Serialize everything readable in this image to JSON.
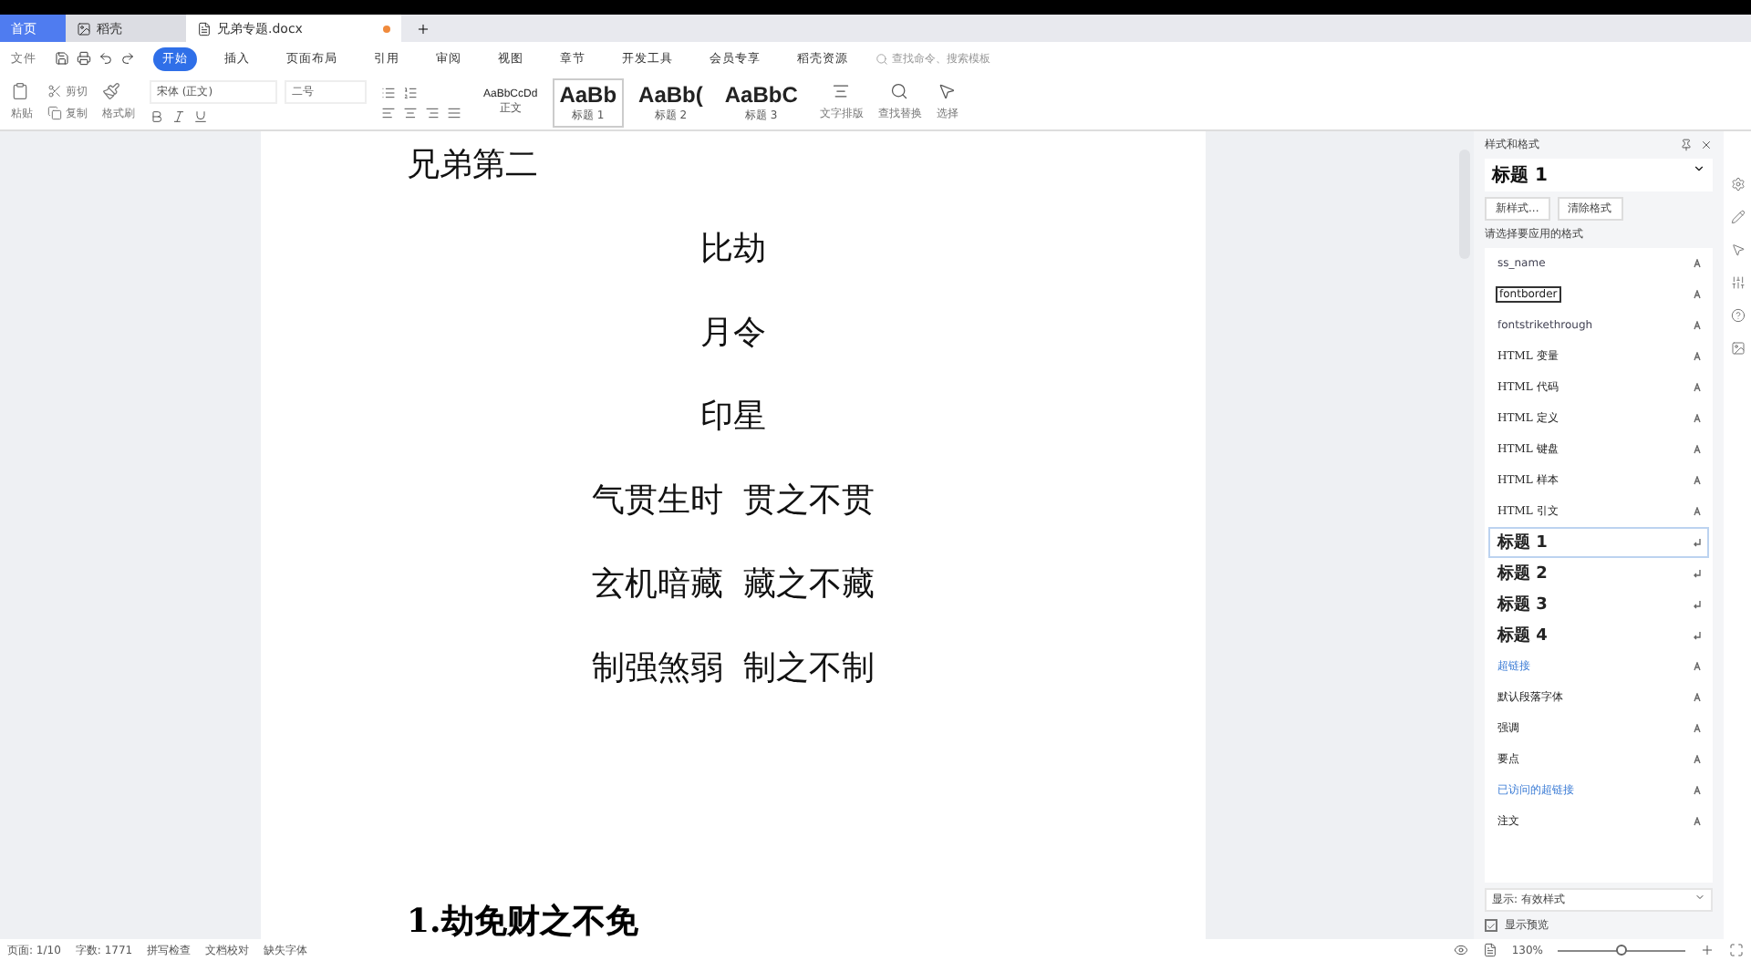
{
  "tabs": [
    {
      "label": "首页",
      "kind": "home",
      "selected": false
    },
    {
      "label": "稻壳",
      "kind": "app",
      "selected": false
    },
    {
      "label": "兄弟专题.docx",
      "kind": "doc",
      "selected": true
    }
  ],
  "menu": {
    "file": "文件",
    "items": [
      {
        "label": "开始",
        "selected": true
      },
      {
        "label": "插入",
        "selected": false
      },
      {
        "label": "页面布局",
        "selected": false
      },
      {
        "label": "引用",
        "selected": false
      },
      {
        "label": "审阅",
        "selected": false
      },
      {
        "label": "视图",
        "selected": false
      },
      {
        "label": "章节",
        "selected": false
      },
      {
        "label": "开发工具",
        "selected": false
      },
      {
        "label": "会员专享",
        "selected": false
      },
      {
        "label": "稻壳资源",
        "selected": false
      }
    ],
    "search": {
      "placeholder": "查找命令、搜索模板"
    }
  },
  "ribbon": {
    "paste": "粘贴",
    "cut": "剪切",
    "copy": "复制",
    "format_painter": "格式刷",
    "font": "宋体 (正文)",
    "size": "二号",
    "styles": [
      {
        "preview": "AaBbCcDd",
        "label": "正文",
        "selected": false
      },
      {
        "preview": "AaBb",
        "label": "标题 1",
        "selected": true
      },
      {
        "preview": "AaBb(",
        "label": "标题 2",
        "selected": false
      },
      {
        "preview": "AaBbC",
        "label": "标题 3",
        "selected": false
      }
    ],
    "tools": [
      "文字排版",
      "查找替换",
      "选择"
    ]
  },
  "document": {
    "lines": [
      {
        "text": "兄弟第二",
        "centered": false
      },
      {
        "text": "比劫",
        "centered": true
      },
      {
        "text": "月令",
        "centered": true
      },
      {
        "text": "印星",
        "centered": true
      },
      {
        "text": "气贯生时  贯之不贯",
        "centered": true
      },
      {
        "text": "玄机暗藏  藏之不藏",
        "centered": true
      },
      {
        "text": "制强煞弱  制之不制",
        "centered": true
      }
    ],
    "heading": "1.劫免财之不免"
  },
  "panel": {
    "title": "样式和格式",
    "current": "标题 1",
    "buttons": [
      "新样式...",
      "清除格式"
    ],
    "prompt": "请选择要应用的格式",
    "styles": [
      {
        "label": "ss_name",
        "kind": "small",
        "selected": false
      },
      {
        "label": "fontborder",
        "kind": "boxed",
        "selected": false
      },
      {
        "label": "fontstrikethrough",
        "kind": "small",
        "selected": false
      },
      {
        "label": "HTML 变量",
        "kind": "html",
        "selected": false
      },
      {
        "label": "HTML 代码",
        "kind": "html",
        "selected": false
      },
      {
        "label": "HTML 定义",
        "kind": "html",
        "selected": false
      },
      {
        "label": "HTML 键盘",
        "kind": "html",
        "selected": false
      },
      {
        "label": "HTML 样本",
        "kind": "html",
        "selected": false
      },
      {
        "label": "HTML 引文",
        "kind": "html",
        "selected": false
      },
      {
        "label": "标题 1",
        "kind": "heading",
        "selected": true
      },
      {
        "label": "标题 2",
        "kind": "heading",
        "selected": false
      },
      {
        "label": "标题 3",
        "kind": "heading",
        "selected": false
      },
      {
        "label": "标题 4",
        "kind": "heading",
        "selected": false
      },
      {
        "label": "超链接",
        "kind": "link",
        "selected": false
      },
      {
        "label": "默认段落字体",
        "kind": "normal",
        "selected": false
      },
      {
        "label": "强调",
        "kind": "normal",
        "selected": false
      },
      {
        "label": "要点",
        "kind": "normal",
        "selected": false
      },
      {
        "label": "已访问的超链接",
        "kind": "link",
        "selected": false
      },
      {
        "label": "注文",
        "kind": "normal",
        "selected": false
      }
    ],
    "show_label": "显示:",
    "show_value": "有效样式",
    "preview": {
      "label": "显示预览",
      "checked": true
    }
  },
  "status": {
    "page": "页面: 1/10",
    "words": "字数: 1771",
    "items": [
      "拼写检查",
      "文档校对",
      "缺失字体"
    ],
    "zoom": "130%",
    "zoom_slider": {
      "level": 0.5
    }
  }
}
